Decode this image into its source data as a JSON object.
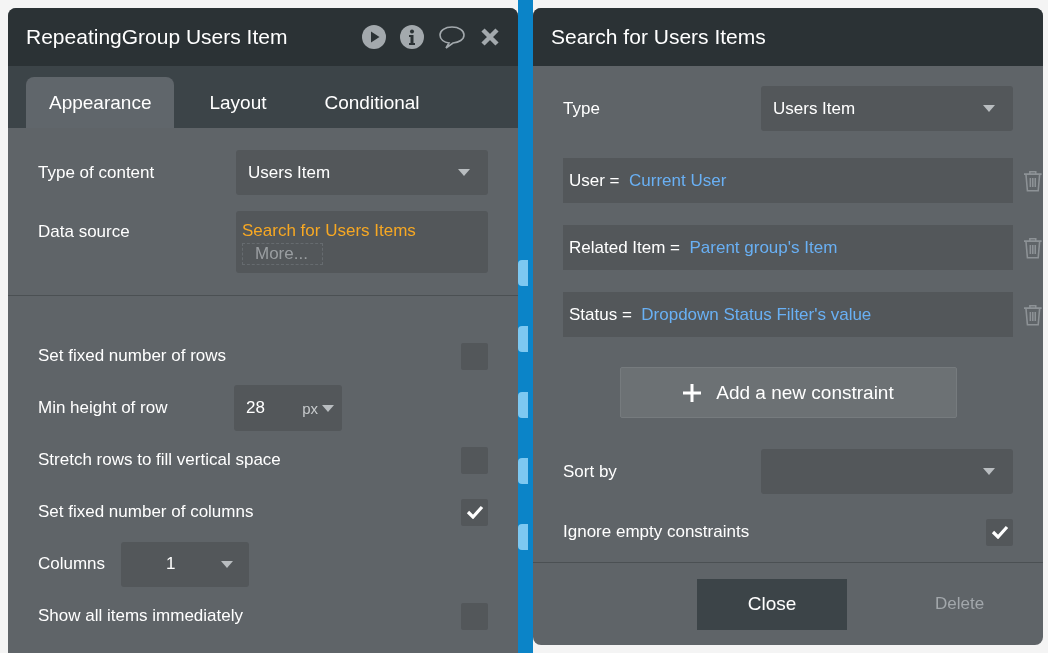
{
  "left_panel": {
    "title": "RepeatingGroup Users Item",
    "tabs": [
      {
        "label": "Appearance",
        "selected": true
      },
      {
        "label": "Layout",
        "selected": false
      },
      {
        "label": "Conditional",
        "selected": false
      }
    ],
    "type_of_content": {
      "label": "Type of content",
      "value": "Users Item"
    },
    "data_source": {
      "label": "Data source",
      "value": "Search for Users Items",
      "more": "More..."
    },
    "settings": [
      {
        "kind": "checkbox",
        "label": "Set fixed number of rows",
        "checked": false
      },
      {
        "kind": "number",
        "label": "Min height of row",
        "value": "28",
        "unit": "px"
      },
      {
        "kind": "checkbox",
        "label": "Stretch rows to fill vertical space",
        "checked": false
      },
      {
        "kind": "checkbox",
        "label": "Set fixed number of columns",
        "checked": true
      },
      {
        "kind": "dropdown",
        "label": "Columns",
        "value": "1"
      },
      {
        "kind": "checkbox",
        "label": "Show all items immediately",
        "checked": false
      }
    ]
  },
  "search_panel": {
    "title": "Search for Users Items",
    "type": {
      "label": "Type",
      "value": "Users Item"
    },
    "constraints": [
      {
        "key": "User =",
        "value": "Current User"
      },
      {
        "key": "Related Item =",
        "value": "Parent group's Item"
      },
      {
        "key": "Status =",
        "value": "Dropdown Status Filter's value"
      }
    ],
    "add_button": "Add a new constraint",
    "sort_by": {
      "label": "Sort by"
    },
    "ignore_empty": {
      "label": "Ignore empty constraints",
      "checked": true
    },
    "buttons": [
      {
        "label": "Close",
        "disabled": false
      },
      {
        "label": "Delete",
        "disabled": true
      }
    ]
  }
}
